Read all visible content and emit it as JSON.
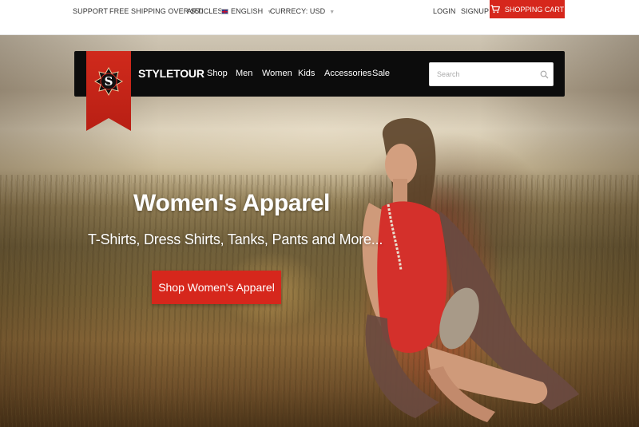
{
  "topbar": {
    "support": "SUPPORT",
    "shipping": "FREE SHIPPING OVER $50",
    "articles": "ARTICLES",
    "language": "ENGLISH",
    "currency": "CURRECY: USD",
    "login": "LOGIN",
    "signup": "SIGNUP",
    "cart": "SHOPPING CART",
    "caret_icon": "caret-down-icon",
    "cart_icon": "cart-icon",
    "flag_icon": "uk-flag-icon"
  },
  "nav": {
    "logo_letter": "S",
    "brand": "STYLETOUR",
    "items": [
      "Shop",
      "Men",
      "Women",
      "Kids",
      "Accessories",
      "Sale"
    ],
    "search_placeholder": "Search",
    "search_icon": "search-icon"
  },
  "hero": {
    "title": "Women's Apparel",
    "subtitle": "T-Shirts, Dress Shirts, Tanks, Pants and More...",
    "cta": "Shop Women's Apparel"
  },
  "colors": {
    "accent": "#d6271c",
    "navbar": "#0c0c0c",
    "topbar_text": "#333333"
  }
}
